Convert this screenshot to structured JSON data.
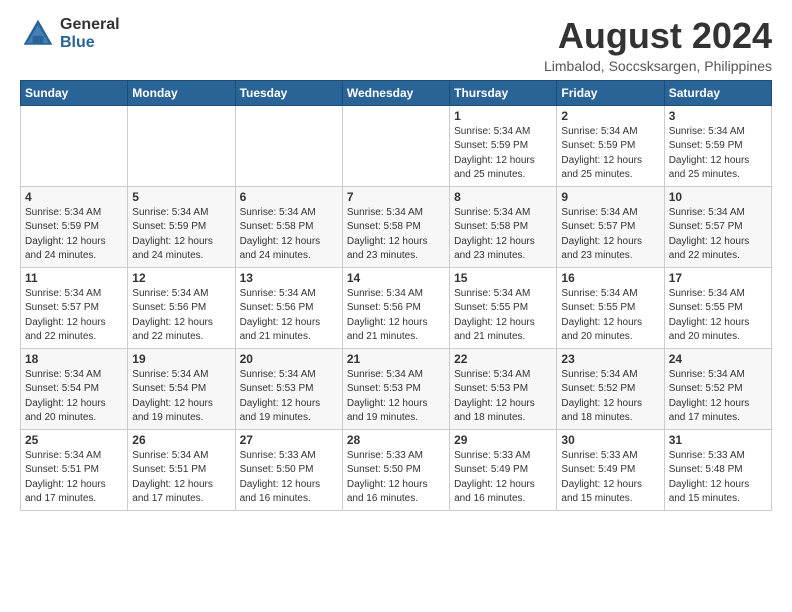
{
  "header": {
    "logo_general": "General",
    "logo_blue": "Blue",
    "month_year": "August 2024",
    "location": "Limbalod, Soccsksargen, Philippines"
  },
  "days_of_week": [
    "Sunday",
    "Monday",
    "Tuesday",
    "Wednesday",
    "Thursday",
    "Friday",
    "Saturday"
  ],
  "weeks": [
    [
      {
        "day": "",
        "info": ""
      },
      {
        "day": "",
        "info": ""
      },
      {
        "day": "",
        "info": ""
      },
      {
        "day": "",
        "info": ""
      },
      {
        "day": "1",
        "info": "Sunrise: 5:34 AM\nSunset: 5:59 PM\nDaylight: 12 hours\nand 25 minutes."
      },
      {
        "day": "2",
        "info": "Sunrise: 5:34 AM\nSunset: 5:59 PM\nDaylight: 12 hours\nand 25 minutes."
      },
      {
        "day": "3",
        "info": "Sunrise: 5:34 AM\nSunset: 5:59 PM\nDaylight: 12 hours\nand 25 minutes."
      }
    ],
    [
      {
        "day": "4",
        "info": "Sunrise: 5:34 AM\nSunset: 5:59 PM\nDaylight: 12 hours\nand 24 minutes."
      },
      {
        "day": "5",
        "info": "Sunrise: 5:34 AM\nSunset: 5:59 PM\nDaylight: 12 hours\nand 24 minutes."
      },
      {
        "day": "6",
        "info": "Sunrise: 5:34 AM\nSunset: 5:58 PM\nDaylight: 12 hours\nand 24 minutes."
      },
      {
        "day": "7",
        "info": "Sunrise: 5:34 AM\nSunset: 5:58 PM\nDaylight: 12 hours\nand 23 minutes."
      },
      {
        "day": "8",
        "info": "Sunrise: 5:34 AM\nSunset: 5:58 PM\nDaylight: 12 hours\nand 23 minutes."
      },
      {
        "day": "9",
        "info": "Sunrise: 5:34 AM\nSunset: 5:57 PM\nDaylight: 12 hours\nand 23 minutes."
      },
      {
        "day": "10",
        "info": "Sunrise: 5:34 AM\nSunset: 5:57 PM\nDaylight: 12 hours\nand 22 minutes."
      }
    ],
    [
      {
        "day": "11",
        "info": "Sunrise: 5:34 AM\nSunset: 5:57 PM\nDaylight: 12 hours\nand 22 minutes."
      },
      {
        "day": "12",
        "info": "Sunrise: 5:34 AM\nSunset: 5:56 PM\nDaylight: 12 hours\nand 22 minutes."
      },
      {
        "day": "13",
        "info": "Sunrise: 5:34 AM\nSunset: 5:56 PM\nDaylight: 12 hours\nand 21 minutes."
      },
      {
        "day": "14",
        "info": "Sunrise: 5:34 AM\nSunset: 5:56 PM\nDaylight: 12 hours\nand 21 minutes."
      },
      {
        "day": "15",
        "info": "Sunrise: 5:34 AM\nSunset: 5:55 PM\nDaylight: 12 hours\nand 21 minutes."
      },
      {
        "day": "16",
        "info": "Sunrise: 5:34 AM\nSunset: 5:55 PM\nDaylight: 12 hours\nand 20 minutes."
      },
      {
        "day": "17",
        "info": "Sunrise: 5:34 AM\nSunset: 5:55 PM\nDaylight: 12 hours\nand 20 minutes."
      }
    ],
    [
      {
        "day": "18",
        "info": "Sunrise: 5:34 AM\nSunset: 5:54 PM\nDaylight: 12 hours\nand 20 minutes."
      },
      {
        "day": "19",
        "info": "Sunrise: 5:34 AM\nSunset: 5:54 PM\nDaylight: 12 hours\nand 19 minutes."
      },
      {
        "day": "20",
        "info": "Sunrise: 5:34 AM\nSunset: 5:53 PM\nDaylight: 12 hours\nand 19 minutes."
      },
      {
        "day": "21",
        "info": "Sunrise: 5:34 AM\nSunset: 5:53 PM\nDaylight: 12 hours\nand 19 minutes."
      },
      {
        "day": "22",
        "info": "Sunrise: 5:34 AM\nSunset: 5:53 PM\nDaylight: 12 hours\nand 18 minutes."
      },
      {
        "day": "23",
        "info": "Sunrise: 5:34 AM\nSunset: 5:52 PM\nDaylight: 12 hours\nand 18 minutes."
      },
      {
        "day": "24",
        "info": "Sunrise: 5:34 AM\nSunset: 5:52 PM\nDaylight: 12 hours\nand 17 minutes."
      }
    ],
    [
      {
        "day": "25",
        "info": "Sunrise: 5:34 AM\nSunset: 5:51 PM\nDaylight: 12 hours\nand 17 minutes."
      },
      {
        "day": "26",
        "info": "Sunrise: 5:34 AM\nSunset: 5:51 PM\nDaylight: 12 hours\nand 17 minutes."
      },
      {
        "day": "27",
        "info": "Sunrise: 5:33 AM\nSunset: 5:50 PM\nDaylight: 12 hours\nand 16 minutes."
      },
      {
        "day": "28",
        "info": "Sunrise: 5:33 AM\nSunset: 5:50 PM\nDaylight: 12 hours\nand 16 minutes."
      },
      {
        "day": "29",
        "info": "Sunrise: 5:33 AM\nSunset: 5:49 PM\nDaylight: 12 hours\nand 16 minutes."
      },
      {
        "day": "30",
        "info": "Sunrise: 5:33 AM\nSunset: 5:49 PM\nDaylight: 12 hours\nand 15 minutes."
      },
      {
        "day": "31",
        "info": "Sunrise: 5:33 AM\nSunset: 5:48 PM\nDaylight: 12 hours\nand 15 minutes."
      }
    ]
  ]
}
